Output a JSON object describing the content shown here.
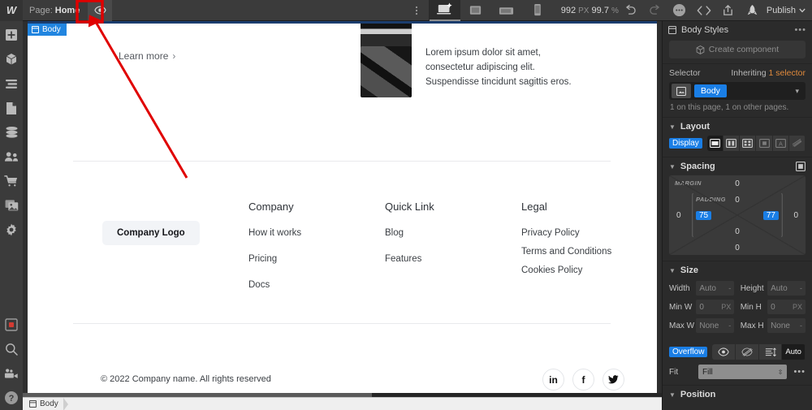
{
  "topbar": {
    "logo": "W",
    "page_prefix": "Page:",
    "page_name": "Home",
    "preview_icon": "eye-icon",
    "more_icon": "vertical-dots-icon",
    "devices": [
      {
        "name": "desktop",
        "label": "desktop-breakpoint",
        "active": true
      },
      {
        "name": "tablet",
        "label": "tablet-breakpoint",
        "active": false
      },
      {
        "name": "mobile-landscape",
        "label": "mobile-landscape-breakpoint",
        "active": false
      },
      {
        "name": "mobile-portrait",
        "label": "mobile-portrait-breakpoint",
        "active": false
      }
    ],
    "canvas_width": "992",
    "canvas_width_unit": "PX",
    "zoom": "99.7",
    "zoom_unit": "%",
    "undo_icon": "undo-icon",
    "redo_icon": "redo-icon",
    "comments_icon": "comments-icon",
    "code_icon": "code-export-icon",
    "share_icon": "share-icon",
    "rocket_icon": "launch-icon",
    "publish_label": "Publish"
  },
  "leftrail": {
    "items": [
      {
        "name": "add-elements",
        "icon": "plus-icon"
      },
      {
        "name": "components",
        "icon": "cube-icon"
      },
      {
        "name": "navigator",
        "icon": "layers-list-icon"
      },
      {
        "name": "pages",
        "icon": "page-icon"
      },
      {
        "name": "cms",
        "icon": "database-icon"
      },
      {
        "name": "users",
        "icon": "people-icon"
      },
      {
        "name": "ecommerce",
        "icon": "cart-icon"
      },
      {
        "name": "assets",
        "icon": "image-icon"
      },
      {
        "name": "settings",
        "icon": "gear-icon"
      }
    ],
    "bottom_items": [
      {
        "name": "interactions",
        "icon": "red-square-icon"
      },
      {
        "name": "search",
        "icon": "search-icon"
      },
      {
        "name": "video-tutorials",
        "icon": "video-camera-icon"
      },
      {
        "name": "help",
        "icon": "question-mark-icon"
      }
    ]
  },
  "canvas": {
    "body_badge": "Body",
    "learn_more": "Learn more",
    "learn_more_chevron": "›",
    "media": [
      {
        "thumb": "dark-abstract-thumbnail-1",
        "text": ""
      },
      {
        "thumb": "dark-abstract-thumbnail-2",
        "text": "Lorem ipsum dolor sit amet, consectetur adipiscing elit. Suspendisse tincidunt sagittis eros."
      }
    ],
    "footer": {
      "logo_text": "Company Logo",
      "columns": [
        {
          "heading": "Company",
          "links": [
            "How it works",
            "Pricing",
            "Docs"
          ]
        },
        {
          "heading": "Quick Link",
          "links": [
            "Blog",
            "Features"
          ]
        },
        {
          "heading": "Legal",
          "links": [
            "Privacy Policy",
            "Terms and Conditions",
            "Cookies Policy"
          ]
        }
      ],
      "copyright": "© 2022 Company name. All rights reserved",
      "socials": [
        {
          "name": "linkedin",
          "glyph": "in"
        },
        {
          "name": "facebook",
          "glyph": "f"
        },
        {
          "name": "twitter",
          "glyph": "twitter-bird"
        }
      ]
    }
  },
  "rightpanel": {
    "tabs": [
      {
        "name": "style",
        "icon": "paintbrush-icon",
        "active": true
      },
      {
        "name": "settings",
        "icon": "gear-icon",
        "active": false
      },
      {
        "name": "interactions",
        "icon": "interactions-icon",
        "active": false
      },
      {
        "name": "effects",
        "icon": "lightning-bolt-icon",
        "active": false
      }
    ],
    "title": "Body Styles",
    "title_icon": "window-icon",
    "title_more": "•••",
    "create_component": "Create component",
    "create_component_icon": "cube-icon",
    "selector": {
      "label": "Selector",
      "inheriting_prefix": "Inheriting",
      "inheriting_value": "1 selector",
      "tag": "Body",
      "tag_icon": "element-icon",
      "caret": "▾",
      "note": "1 on this page, 1 on other pages."
    },
    "layout": {
      "heading": "Layout",
      "display_label": "Display",
      "options": [
        {
          "name": "block",
          "active": true
        },
        {
          "name": "flex",
          "active": false
        },
        {
          "name": "grid",
          "active": false
        },
        {
          "name": "inline-block",
          "active": false
        },
        {
          "name": "inline",
          "active": false
        },
        {
          "name": "none",
          "active": false
        }
      ]
    },
    "spacing": {
      "heading": "Spacing",
      "margin_label": "MARGIN",
      "padding_label": "PADDING",
      "margin": {
        "top": "0",
        "right": "0",
        "bottom": "0",
        "left": "0"
      },
      "padding": {
        "top": "0",
        "right": "77",
        "bottom": "0",
        "left": "75"
      }
    },
    "size": {
      "heading": "Size",
      "rows": [
        {
          "label": "Width",
          "value": "Auto",
          "unit": "-",
          "label2": "Height",
          "value2": "Auto",
          "unit2": "-"
        },
        {
          "label": "Min W",
          "value": "0",
          "unit": "PX",
          "label2": "Min H",
          "value2": "0",
          "unit2": "PX"
        },
        {
          "label": "Max W",
          "value": "None",
          "unit": "-",
          "label2": "Max H",
          "value2": "None",
          "unit2": "-"
        }
      ],
      "overflow_label": "Overflow",
      "overflow_options": [
        {
          "name": "visible",
          "icon": "eye-icon",
          "active": false
        },
        {
          "name": "hidden",
          "icon": "eye-slash-icon",
          "active": false
        },
        {
          "name": "scroll",
          "icon": "scroll-icon",
          "active": false
        },
        {
          "name": "auto",
          "icon": "",
          "label": "Auto",
          "active": true
        }
      ],
      "fit_label": "Fit",
      "fit_value": "Fill",
      "fit_more": "•••"
    },
    "position": {
      "heading": "Position"
    }
  },
  "bottombar": {
    "breadcrumb": "Body",
    "breadcrumb_icon": "window-icon"
  },
  "annotation": {
    "type": "arrow-and-box",
    "color": "#e00000",
    "points_to": "eye-icon"
  }
}
